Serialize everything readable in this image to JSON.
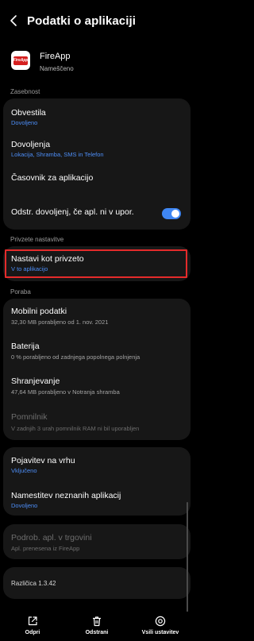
{
  "header": {
    "title": "Podatki o aplikaciji"
  },
  "app": {
    "logo_text": "FireApp",
    "name": "FireApp",
    "status": "Nameščeno"
  },
  "sections": {
    "usage": "Zasebnost",
    "defaults": "Privzete nastavitve",
    "storage": "Poraba"
  },
  "privacy_card": {
    "notifications": {
      "title": "Obvestila",
      "subtitle": "Dovoljeno"
    },
    "permissions": {
      "title": "Dovoljenja",
      "subtitle": "Lokacija, Shramba, SMS in Telefon"
    },
    "screen_time": {
      "title": "Časovnik za aplikacijo"
    },
    "remove_permissions": {
      "title": "Odstr. dovoljenj, če apl. ni v upor.",
      "toggle_on": true
    }
  },
  "defaults_card": {
    "set_default": {
      "title": "Nastavi kot privzeto",
      "subtitle": "V to aplikacijo"
    }
  },
  "usage_card": {
    "mobile_data": {
      "title": "Mobilni podatki",
      "subtitle": "32,30 MB porabljeno od 1. nov. 2021"
    },
    "battery": {
      "title": "Baterija",
      "subtitle": "0 % porabljeno od zadnjega popolnega polnjenja"
    },
    "storage": {
      "title": "Shranjevanje",
      "subtitle": "47,64 MB porabljeno v Notranja shramba"
    },
    "memory": {
      "title": "Pomnilnik",
      "subtitle": "V zadnjih 3 urah pomnilnik RAM ni bil uporabljen"
    }
  },
  "advanced_card": {
    "appear_on_top": {
      "title": "Pojavitev na vrhu",
      "subtitle": "Vključeno"
    },
    "install_unknown": {
      "title": "Namestitev neznanih aplikacij",
      "subtitle": "Dovoljeno"
    }
  },
  "store_card": {
    "store_details": {
      "title": "Podrob. apl. v trgovini",
      "subtitle": "Apl. prenesena iz FireApp"
    }
  },
  "version_card": {
    "version": "Različica 1.3.42"
  },
  "bottom_bar": {
    "open": "Odpri",
    "uninstall": "Odstrani",
    "force_stop": "Vsili ustavitev"
  },
  "colors": {
    "accent": "#4d8ef7",
    "toggle": "#3f86f2",
    "highlight": "#e52b2b",
    "card": "#171717",
    "background": "#000000"
  }
}
